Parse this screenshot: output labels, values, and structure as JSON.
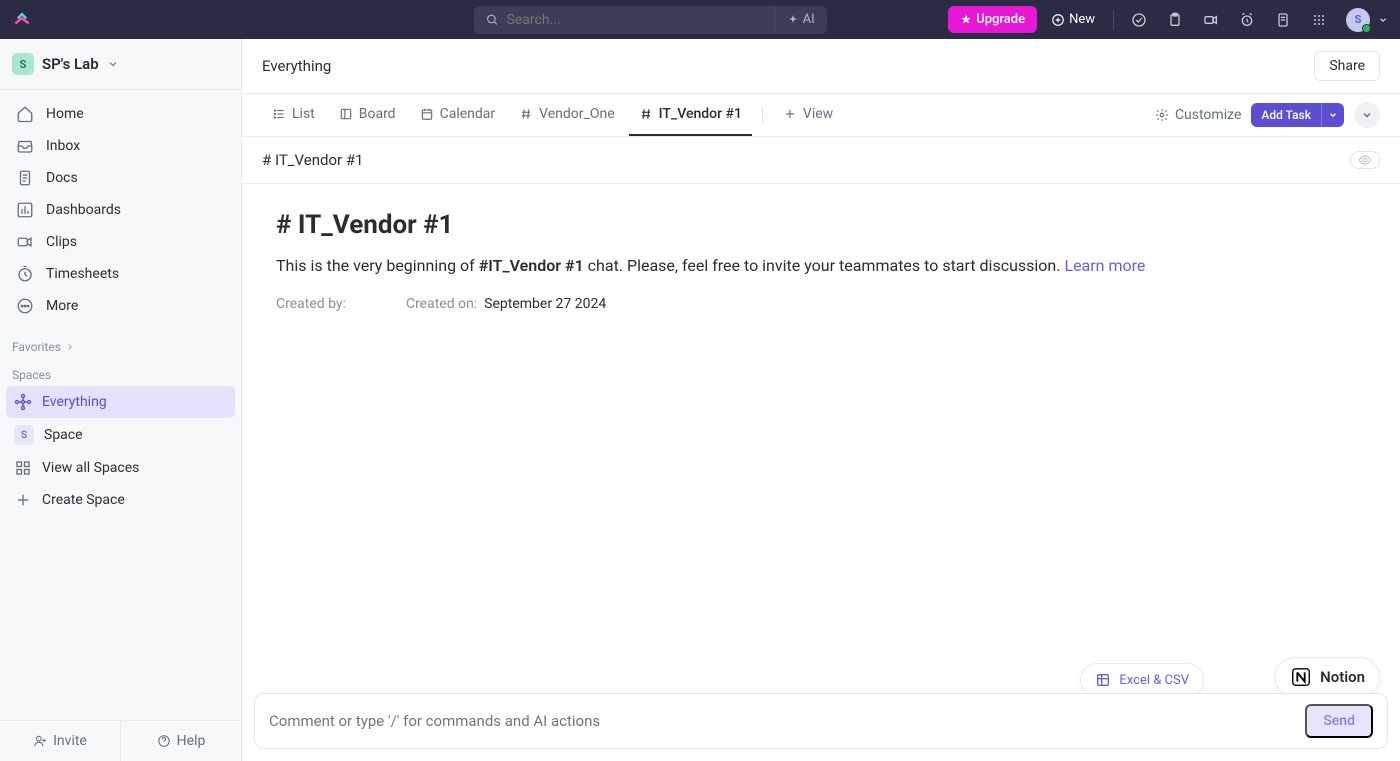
{
  "topbar": {
    "search_placeholder": "Search...",
    "ai_label": "AI",
    "upgrade_label": "Upgrade",
    "new_label": "New",
    "avatar_initial": "S"
  },
  "workspace": {
    "initial": "S",
    "name": "SP's Lab"
  },
  "nav": {
    "home": "Home",
    "inbox": "Inbox",
    "docs": "Docs",
    "dashboards": "Dashboards",
    "clips": "Clips",
    "timesheets": "Timesheets",
    "more": "More"
  },
  "sidebar": {
    "favorites_label": "Favorites",
    "spaces_label": "Spaces",
    "everything": "Everything",
    "space_initial": "S",
    "space_name": "Space",
    "view_all": "View all Spaces",
    "create_space": "Create Space",
    "invite": "Invite",
    "help": "Help"
  },
  "header": {
    "breadcrumb": "Everything",
    "share": "Share"
  },
  "tabs": {
    "list": "List",
    "board": "Board",
    "calendar": "Calendar",
    "vendor_one": "Vendor_One",
    "it_vendor": "IT_Vendor #1",
    "view": "View",
    "customize": "Customize",
    "add_task": "Add Task"
  },
  "subheader": {
    "title": "# IT_Vendor #1"
  },
  "chat": {
    "title": "# IT_Vendor #1",
    "desc_pre": "This is the very beginning of ",
    "desc_bold": "#IT_Vendor #1",
    "desc_post": " chat. Please, feel free to invite your teammates to start discussion. ",
    "learn_more": "Learn more",
    "created_by_label": "Created by:",
    "created_on_label": "Created on:",
    "created_on_value": "September 27 2024"
  },
  "composer": {
    "placeholder": "Comment or type '/' for commands and AI actions",
    "send": "Send"
  },
  "pills": {
    "excel": "Excel & CSV",
    "notion": "Notion"
  }
}
